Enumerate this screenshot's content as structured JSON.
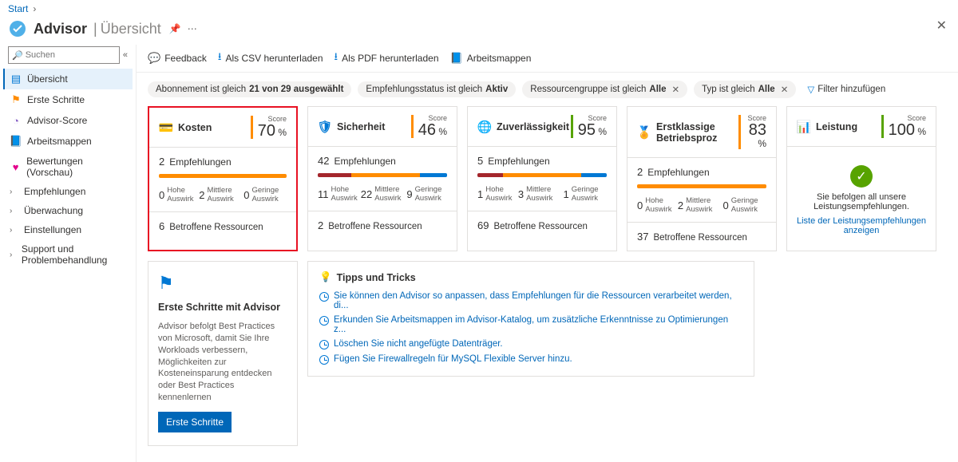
{
  "breadcrumb": {
    "start": "Start"
  },
  "header": {
    "title": "Advisor",
    "subtitle": "Übersicht"
  },
  "search": {
    "placeholder": "Suchen"
  },
  "sidebar": {
    "items": [
      {
        "label": "Übersicht"
      },
      {
        "label": "Erste Schritte"
      },
      {
        "label": "Advisor-Score"
      },
      {
        "label": "Arbeitsmappen"
      },
      {
        "label": "Bewertungen (Vorschau)"
      },
      {
        "label": "Empfehlungen"
      },
      {
        "label": "Überwachung"
      },
      {
        "label": "Einstellungen"
      },
      {
        "label": "Support und Problembehandlung"
      }
    ]
  },
  "toolbar": {
    "feedback": "Feedback",
    "csv": "Als CSV herunterladen",
    "pdf": "Als PDF herunterladen",
    "workbooks": "Arbeitsmappen"
  },
  "filters": {
    "sub_prefix": "Abonnement ist gleich ",
    "sub_value": "21 von 29 ausgewählt",
    "status_prefix": "Empfehlungsstatus ist gleich ",
    "status_value": "Aktiv",
    "rg_prefix": "Ressourcengruppe ist gleich ",
    "rg_value": "Alle",
    "type_prefix": "Typ ist gleich ",
    "type_value": "Alle",
    "add": "Filter hinzufügen"
  },
  "common": {
    "score_label": "Score",
    "recs_label": "Empfehlungen",
    "high": "Hohe Auswirk",
    "med": "Mittlere Auswirk",
    "low": "Geringe Auswirk",
    "resources": "Betroffene Ressourcen"
  },
  "cards": {
    "cost": {
      "title": "Kosten",
      "score": "70",
      "recs": "2",
      "high": "0",
      "med": "2",
      "low": "0",
      "res": "6",
      "bar": {
        "h": 0,
        "m": 100,
        "l": 0
      }
    },
    "sec": {
      "title": "Sicherheit",
      "score": "46",
      "recs": "42",
      "high": "11",
      "med": "22",
      "low": "9",
      "res": "2",
      "bar": {
        "h": 26,
        "m": 53,
        "l": 21
      }
    },
    "rel": {
      "title": "Zuverlässigkeit",
      "score": "95",
      "recs": "5",
      "high": "1",
      "med": "3",
      "low": "1",
      "res": "69",
      "bar": {
        "h": 20,
        "m": 60,
        "l": 20
      }
    },
    "opex": {
      "title": "Erstklassige Betriebsproz",
      "score": "83",
      "recs": "2",
      "high": "0",
      "med": "2",
      "low": "0",
      "res": "37",
      "bar": {
        "h": 0,
        "m": 100,
        "l": 0
      }
    },
    "perf": {
      "title": "Leistung",
      "score": "100",
      "msg": "Sie befolgen all unsere Leistungsempfehlungen.",
      "link": "Liste der Leistungsempfehlungen anzeigen"
    }
  },
  "gs": {
    "title": "Erste Schritte mit Advisor",
    "desc": "Advisor befolgt Best Practices von Microsoft, damit Sie Ihre Workloads verbessern, Möglichkeiten zur Kosteneinsparung entdecken oder Best Practices kennenlernen",
    "button": "Erste Schritte"
  },
  "tips": {
    "title": "Tipps und Tricks",
    "items": [
      "Sie können den Advisor so anpassen, dass Empfehlungen für die Ressourcen verarbeitet werden, di...",
      "Erkunden Sie Arbeitsmappen im Advisor-Katalog, um zusätzliche Erkenntnisse zu Optimierungen z...",
      "Löschen Sie nicht angefügte Datenträger.",
      "Fügen Sie Firewallregeln für MySQL Flexible Server hinzu."
    ]
  }
}
